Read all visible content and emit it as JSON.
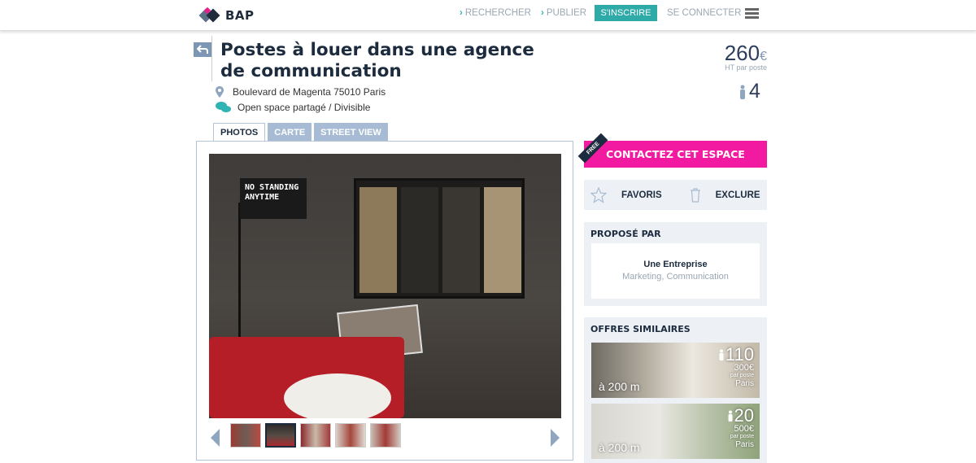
{
  "header": {
    "logo_text": "BAP",
    "nav": {
      "search": "RECHERCHER",
      "publish": "PUBLIER",
      "signup": "S'INSCRIRE",
      "login": "SE CONNECTER"
    }
  },
  "listing": {
    "title": "Postes à louer dans une agence de communication",
    "address": "Boulevard de Magenta 75010 Paris",
    "type": "Open space partagé / Divisible",
    "price": "260",
    "currency": "€",
    "price_unit": "HT par poste",
    "capacity": "4"
  },
  "tabs": [
    {
      "label": "PHOTOS"
    },
    {
      "label": "CARTE"
    },
    {
      "label": "STREET VIEW"
    }
  ],
  "photo": {
    "sign_text": "NO STANDING ANYTIME",
    "thumbnail_count": 5,
    "selected_thumbnail": 2
  },
  "actions": {
    "contact": "CONTACTEZ CET ESPACE",
    "free_badge": "FREE",
    "favorites": "FAVORIS",
    "exclude": "EXCLURE"
  },
  "proposed_by": {
    "title": "PROPOSÉ PAR",
    "name": "Une Entreprise",
    "sector": "Marketing, Communication"
  },
  "similar": {
    "title": "OFFRES SIMILAIRES",
    "offers": [
      {
        "distance": "à 200 m",
        "capacity": "110",
        "price": "300€",
        "unit": "par poste",
        "city": "Paris"
      },
      {
        "distance": "à 200 m",
        "capacity": "20",
        "price": "500€",
        "unit": "par poste",
        "city": "Paris"
      }
    ]
  },
  "colors": {
    "accent_teal": "#2eaaa9",
    "accent_pink": "#f21aa0",
    "navy": "#1c2b3e",
    "tab_inactive": "#a7bcd4"
  }
}
